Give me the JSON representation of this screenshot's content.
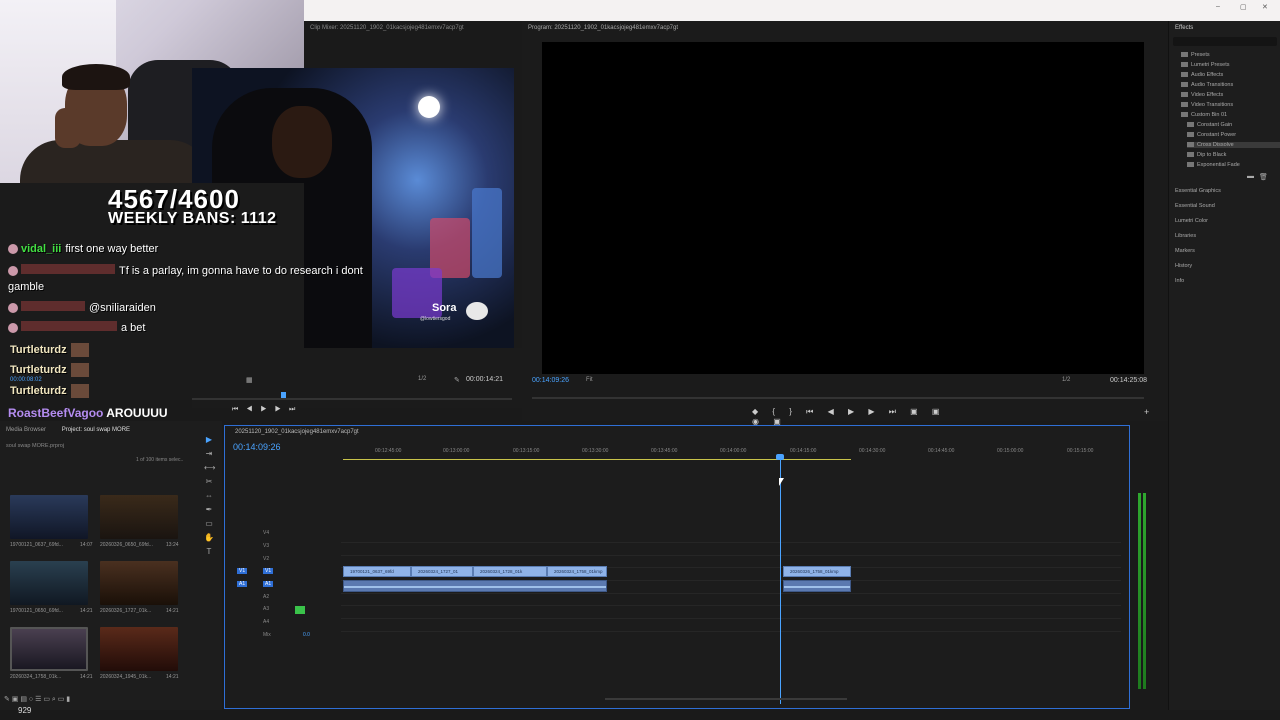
{
  "overlay": {
    "counter": "4567/4600",
    "weekly_bans": "WEEKLY BANS: 1112"
  },
  "chat": {
    "lines": [
      {
        "user": "vidal_iii",
        "text": "first one way better",
        "color": "#43e043"
      },
      {
        "user": "",
        "text": "Tf is a parlay, im gonna have to do research i dont",
        "color": "#e05050"
      },
      {
        "user": "",
        "text": "gamble",
        "color": "#ffffff"
      },
      {
        "user": "",
        "text": "@sniliaraiden",
        "color": "#e05050"
      },
      {
        "user": "",
        "text": "a bet",
        "color": "#e05050"
      }
    ],
    "turtle_user": "Turtleturdz",
    "timestamp": "00:00:08:02",
    "bottom_user": "RoastBeefVagoo",
    "bottom_text": "AROUUUU"
  },
  "source_monitor": {
    "title": "Clip Mixer: 20251120_1902_01kacsjojeg481emxv7acp7gt",
    "ratio": "1/2",
    "duration": "00:00:14:21",
    "watermark": "Sora",
    "watermark_handle": "@lowtiersgod"
  },
  "program_monitor": {
    "title": "Program: 20251120_1902_01kacsjojeg481emxv7acp7gt",
    "timecode": "00:14:09:26",
    "fit": "Fit",
    "ratio": "1/2",
    "duration": "00:14:25:08"
  },
  "effects_panel": {
    "title": "Effects",
    "items": [
      {
        "label": "Presets",
        "level": 0
      },
      {
        "label": "Lumetri Presets",
        "level": 0
      },
      {
        "label": "Audio Effects",
        "level": 0
      },
      {
        "label": "Audio Transitions",
        "level": 0
      },
      {
        "label": "Video Effects",
        "level": 0
      },
      {
        "label": "Video Transitions",
        "level": 0
      },
      {
        "label": "Custom Bin 01",
        "level": 0
      },
      {
        "label": "Constant Gain",
        "level": 1
      },
      {
        "label": "Constant Power",
        "level": 1
      },
      {
        "label": "Cross Dissolve",
        "level": 1
      },
      {
        "label": "Dip to Black",
        "level": 1
      },
      {
        "label": "Exponential Fade",
        "level": 1
      }
    ],
    "panels": [
      "Essential Graphics",
      "Essential Sound",
      "Lumetri Color",
      "Libraries",
      "Markers",
      "History",
      "Info"
    ]
  },
  "project_panel": {
    "tab_media": "Media Browser",
    "tab_project": "Project: soul swap MORE",
    "path": "soul swap MORE.prproj",
    "count": "1 of 100 items selec..",
    "thumbs": [
      {
        "name": "19700121_0637_69fd...",
        "dur": "14:07"
      },
      {
        "name": "20260326_0650_69fd...",
        "dur": "13:24"
      },
      {
        "name": "19700121_0650_69fd...",
        "dur": "14:21"
      },
      {
        "name": "20260326_1727_01k...",
        "dur": "14:21"
      },
      {
        "name": "20260324_1758_01k...",
        "dur": "14:21"
      },
      {
        "name": "20260324_1945_01k...",
        "dur": "14:21"
      },
      {
        "name": "20260326_1758_01k...",
        "dur": "14:21"
      },
      {
        "name": "20260326_1758_02k...",
        "dur": "14:21"
      }
    ],
    "bottom_count": "929"
  },
  "timeline": {
    "title": "20251120_1902_01kacsjojeg481emxv7acp7gt",
    "timecode": "00:14:09:26",
    "ticks": [
      "00:12:45:00",
      "00:13:00:00",
      "00:13:15:00",
      "00:13:30:00",
      "00:13:45:00",
      "00:14:00:00",
      "00:14:15:00",
      "00:14:30:00",
      "00:14:45:00",
      "00:15:00:00",
      "00:15:15:00"
    ],
    "tracks": [
      "V4",
      "V3",
      "V2",
      "V1",
      "A1",
      "A2",
      "A3",
      "A4",
      "Mix"
    ],
    "mix_value": "0.0",
    "clips": [
      "19700121_0637_69fd",
      "20260324_1727_01",
      "20260324_1728_01k",
      "20260324_1758_01kmp",
      "20260326_1758_01kmp"
    ]
  }
}
